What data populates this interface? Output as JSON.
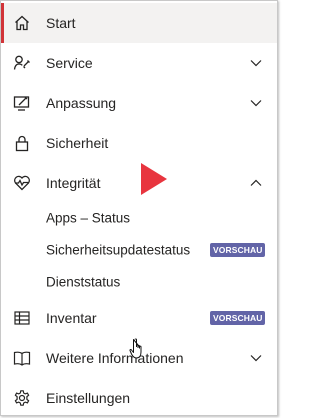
{
  "nav": {
    "start": {
      "label": "Start",
      "icon": "home-icon"
    },
    "service": {
      "label": "Service",
      "icon": "wrench-icon"
    },
    "anpassung": {
      "label": "Anpassung",
      "icon": "customize-icon"
    },
    "sicherheit": {
      "label": "Sicherheit",
      "icon": "lock-icon"
    },
    "integritaet": {
      "label": "Integrität",
      "icon": "heart-pulse-icon",
      "children": [
        {
          "label": "Apps – Status"
        },
        {
          "label": "Sicherheitsupdatestatus",
          "badge": "VORSCHAU"
        },
        {
          "label": "Dienststatus"
        }
      ]
    },
    "inventar": {
      "label": "Inventar",
      "icon": "table-icon",
      "badge": "VORSCHAU"
    },
    "weitere": {
      "label": "Weitere Informationen",
      "icon": "book-icon"
    },
    "einstellungen": {
      "label": "Einstellungen",
      "icon": "gear-icon"
    }
  },
  "colors": {
    "active_indicator": "#d13438",
    "active_background": "#f3f2f1",
    "badge_background": "#6264a7",
    "annotation_arrow": "#e8353f"
  }
}
